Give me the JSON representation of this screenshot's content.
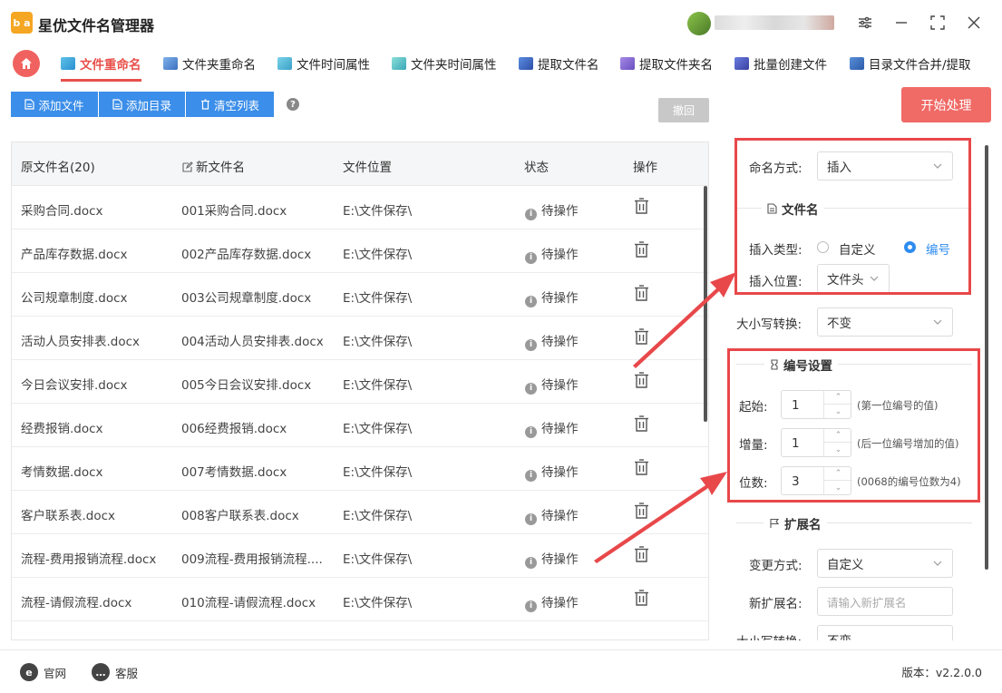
{
  "app": {
    "logo_text": "b a",
    "title": "星优文件名管理器"
  },
  "tabs": [
    {
      "label": "文件重命名",
      "active": true
    },
    {
      "label": "文件夹重命名"
    },
    {
      "label": "文件时间属性"
    },
    {
      "label": "文件夹时间属性"
    },
    {
      "label": "提取文件名"
    },
    {
      "label": "提取文件夹名"
    },
    {
      "label": "批量创建文件"
    },
    {
      "label": "目录文件合并/提取"
    }
  ],
  "toolbar": {
    "add_file": "添加文件",
    "add_dir": "添加目录",
    "clear_list": "清空列表",
    "undo": "撤回",
    "start": "开始处理"
  },
  "table": {
    "headers": {
      "original": "原文件名(20)",
      "new_name": "新文件名",
      "location": "文件位置",
      "status": "状态",
      "action": "操作"
    },
    "rows": [
      {
        "original": "采购合同.docx",
        "new_name": "001采购合同.docx",
        "location": "E:\\文件保存\\",
        "status": "待操作"
      },
      {
        "original": "产品库存数据.docx",
        "new_name": "002产品库存数据.docx",
        "location": "E:\\文件保存\\",
        "status": "待操作"
      },
      {
        "original": "公司规章制度.docx",
        "new_name": "003公司规章制度.docx",
        "location": "E:\\文件保存\\",
        "status": "待操作"
      },
      {
        "original": "活动人员安排表.docx",
        "new_name": "004活动人员安排表.docx",
        "location": "E:\\文件保存\\",
        "status": "待操作"
      },
      {
        "original": "今日会议安排.docx",
        "new_name": "005今日会议安排.docx",
        "location": "E:\\文件保存\\",
        "status": "待操作"
      },
      {
        "original": "经费报销.docx",
        "new_name": "006经费报销.docx",
        "location": "E:\\文件保存\\",
        "status": "待操作"
      },
      {
        "original": "考情数据.docx",
        "new_name": "007考情数据.docx",
        "location": "E:\\文件保存\\",
        "status": "待操作"
      },
      {
        "original": "客户联系表.docx",
        "new_name": "008客户联系表.docx",
        "location": "E:\\文件保存\\",
        "status": "待操作"
      },
      {
        "original": "流程-费用报销流程.docx",
        "new_name": "009流程-费用报销流程....",
        "location": "E:\\文件保存\\",
        "status": "待操作"
      },
      {
        "original": "流程-请假流程.docx",
        "new_name": "010流程-请假流程.docx",
        "location": "E:\\文件保存\\",
        "status": "待操作"
      }
    ]
  },
  "panel": {
    "naming_mode_label": "命名方式:",
    "naming_mode_value": "插入",
    "filename_section": "文件名",
    "insert_type_label": "插入类型:",
    "insert_type_options": [
      "自定义",
      "编号"
    ],
    "insert_type_selected": "编号",
    "insert_pos_label": "插入位置:",
    "insert_pos_value": "文件头",
    "case_label": "大小写转换:",
    "case_value": "不变",
    "numbering_section": "编号设置",
    "start_label": "起始:",
    "start_value": "1",
    "start_hint": "(第一位编号的值)",
    "step_label": "增量:",
    "step_value": "1",
    "step_hint": "(后一位编号增加的值)",
    "digits_label": "位数:",
    "digits_value": "3",
    "digits_hint": "(0068的编号位数为4)",
    "ext_section": "扩展名",
    "ext_mode_label": "变更方式:",
    "ext_mode_value": "自定义",
    "new_ext_label": "新扩展名:",
    "new_ext_placeholder": "请输入新扩展名",
    "ext_case_label": "大小写转换:",
    "ext_case_value": "不变"
  },
  "footer": {
    "website": "官网",
    "support": "客服",
    "version": "版本：v2.2.0.0"
  },
  "colors": {
    "accent_red": "#e8504b",
    "primary_blue": "#3b8ee9",
    "annotation_red": "#e8484a"
  }
}
